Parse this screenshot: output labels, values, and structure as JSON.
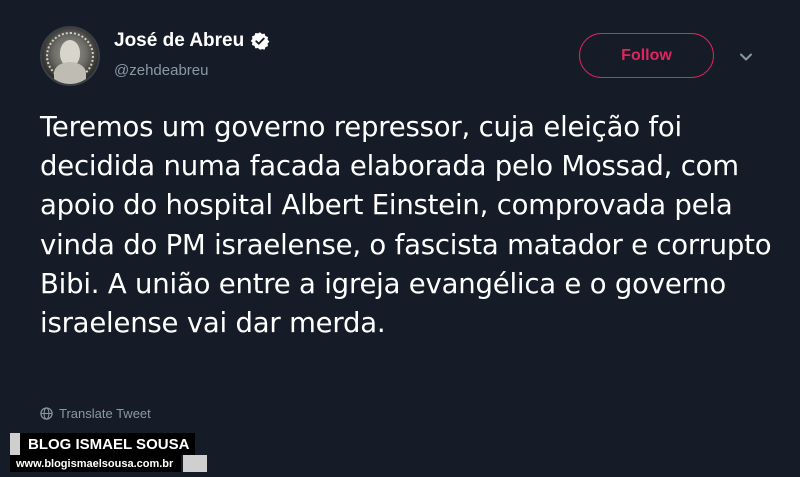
{
  "author": {
    "display_name": "José de Abreu",
    "handle": "@zehdeabreu",
    "verified": true,
    "avatar_icon": "avatar-photo"
  },
  "actions": {
    "follow_label": "Follow",
    "menu_icon": "chevron-down-icon"
  },
  "tweet": {
    "text": "Teremos um governo repressor, cuja eleição foi decidida numa facada elaborada pelo Mossad, com apoio do hospital Albert Einstein, comprovada pela vinda do PM israelense, o fascista matador e corrupto Bibi. A união entre a igreja evangélica e o governo israelense vai dar merda.",
    "translate_label": "Translate Tweet"
  },
  "watermark": {
    "title": "BLOG ISMAEL SOUSA",
    "url": "www.blogismaelsousa.com.br"
  },
  "colors": {
    "background": "#151c27",
    "accent": "#e0245e",
    "muted": "#8899a6",
    "verified": "#ffffff"
  }
}
